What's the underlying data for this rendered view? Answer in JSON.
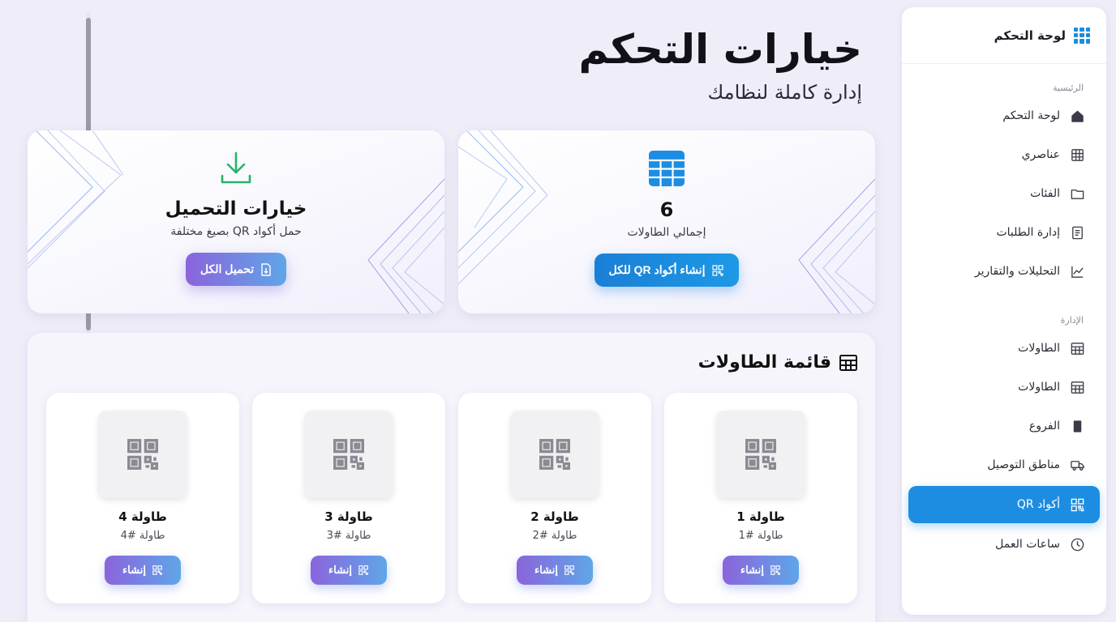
{
  "sidebar": {
    "title": "لوحة التحكم",
    "sections": [
      {
        "label": "الرئيسية",
        "items": [
          {
            "label": "لوحة التحكم",
            "icon": "home-icon"
          },
          {
            "label": "عناصري",
            "icon": "grid-icon"
          },
          {
            "label": "الفئات",
            "icon": "folder-icon"
          },
          {
            "label": "إدارة الطلبات",
            "icon": "receipt-icon"
          },
          {
            "label": "التحليلات والتقارير",
            "icon": "chart-icon"
          }
        ]
      },
      {
        "label": "الإدارة",
        "items": [
          {
            "label": "الطاولات",
            "icon": "table-icon"
          },
          {
            "label": "الطاولات",
            "icon": "table-icon"
          },
          {
            "label": "الفروع",
            "icon": "building-icon"
          },
          {
            "label": "مناطق التوصيل",
            "icon": "truck-icon"
          },
          {
            "label": "أكواد QR",
            "icon": "qr-icon",
            "active": true
          },
          {
            "label": "ساعات العمل",
            "icon": "clock-icon"
          }
        ]
      }
    ]
  },
  "header": {
    "title": "خيارات التحكم",
    "subtitle": "إدارة كاملة لنظامك"
  },
  "stats_card": {
    "value": "6",
    "label": "إجمالي الطاولات",
    "button": "إنشاء أكواد QR للكل"
  },
  "download_card": {
    "title": "خيارات التحميل",
    "description": "حمل أكواد QR بصيغ مختلفة",
    "button": "تحميل الكل"
  },
  "tables_panel": {
    "title": "قائمة الطاولات",
    "button_label": "إنشاء",
    "tables": [
      {
        "name": "طاولة 1",
        "sub": "طاولة #1"
      },
      {
        "name": "طاولة 2",
        "sub": "طاولة #2"
      },
      {
        "name": "طاولة 3",
        "sub": "طاولة #3"
      },
      {
        "name": "طاولة 4",
        "sub": "طاولة #4"
      }
    ]
  },
  "colors": {
    "accent": "#1d8de2",
    "gradient_start": "#8b64dc",
    "gradient_end": "#5fa6e8",
    "download_icon": "#27b36b"
  }
}
